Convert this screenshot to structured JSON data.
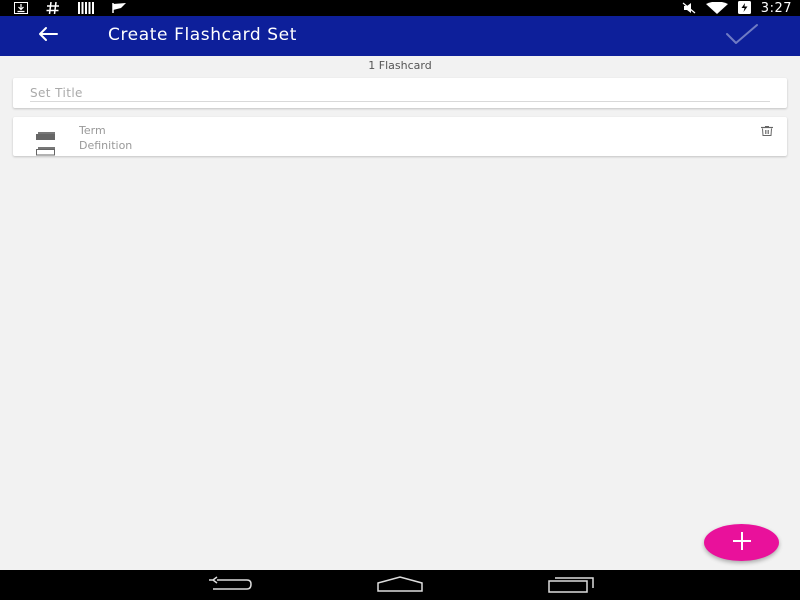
{
  "status_bar": {
    "left_icons": [
      "download-icon",
      "hash-icon",
      "barcode-icon",
      "flag-icon"
    ],
    "right_icons": [
      "muted-icon",
      "wifi-icon",
      "battery-charging-icon"
    ],
    "time": "3:27"
  },
  "app_bar": {
    "title": "Create Flashcard Set",
    "background": "#0d1f9a",
    "back_icon": "arrow-back-icon",
    "done_icon": "checkmark-icon"
  },
  "flashcard_count": "1 Flashcard",
  "set_title": {
    "placeholder": "Set Title",
    "value": ""
  },
  "cards": [
    {
      "term_placeholder": "Term",
      "definition_placeholder": "Definition",
      "term_icon": "card-filled-icon",
      "definition_icon": "card-outline-icon",
      "delete_icon": "trash-icon"
    }
  ],
  "fab": {
    "icon": "plus-icon",
    "color": "#e9119b"
  },
  "nav_bar": {
    "buttons": [
      "back-nav-icon",
      "home-nav-icon",
      "recents-nav-icon"
    ]
  }
}
